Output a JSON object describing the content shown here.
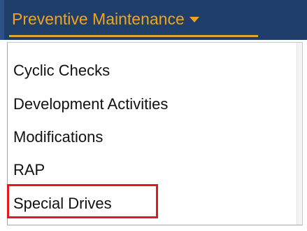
{
  "nav": {
    "title": "Preventive Maintenance",
    "caret_icon": "caret-down-icon"
  },
  "menu": {
    "items": [
      {
        "label": "Cyclic Checks"
      },
      {
        "label": "Development Activities"
      },
      {
        "label": "Modifications"
      },
      {
        "label": "RAP"
      },
      {
        "label": "Special Drives"
      }
    ],
    "highlighted_item": "Special Drives"
  },
  "colors": {
    "nav_background": "#1f3f6a",
    "nav_text": "#f0a41c",
    "underline": "#e3a52d",
    "highlight_border": "#e01b1b"
  }
}
